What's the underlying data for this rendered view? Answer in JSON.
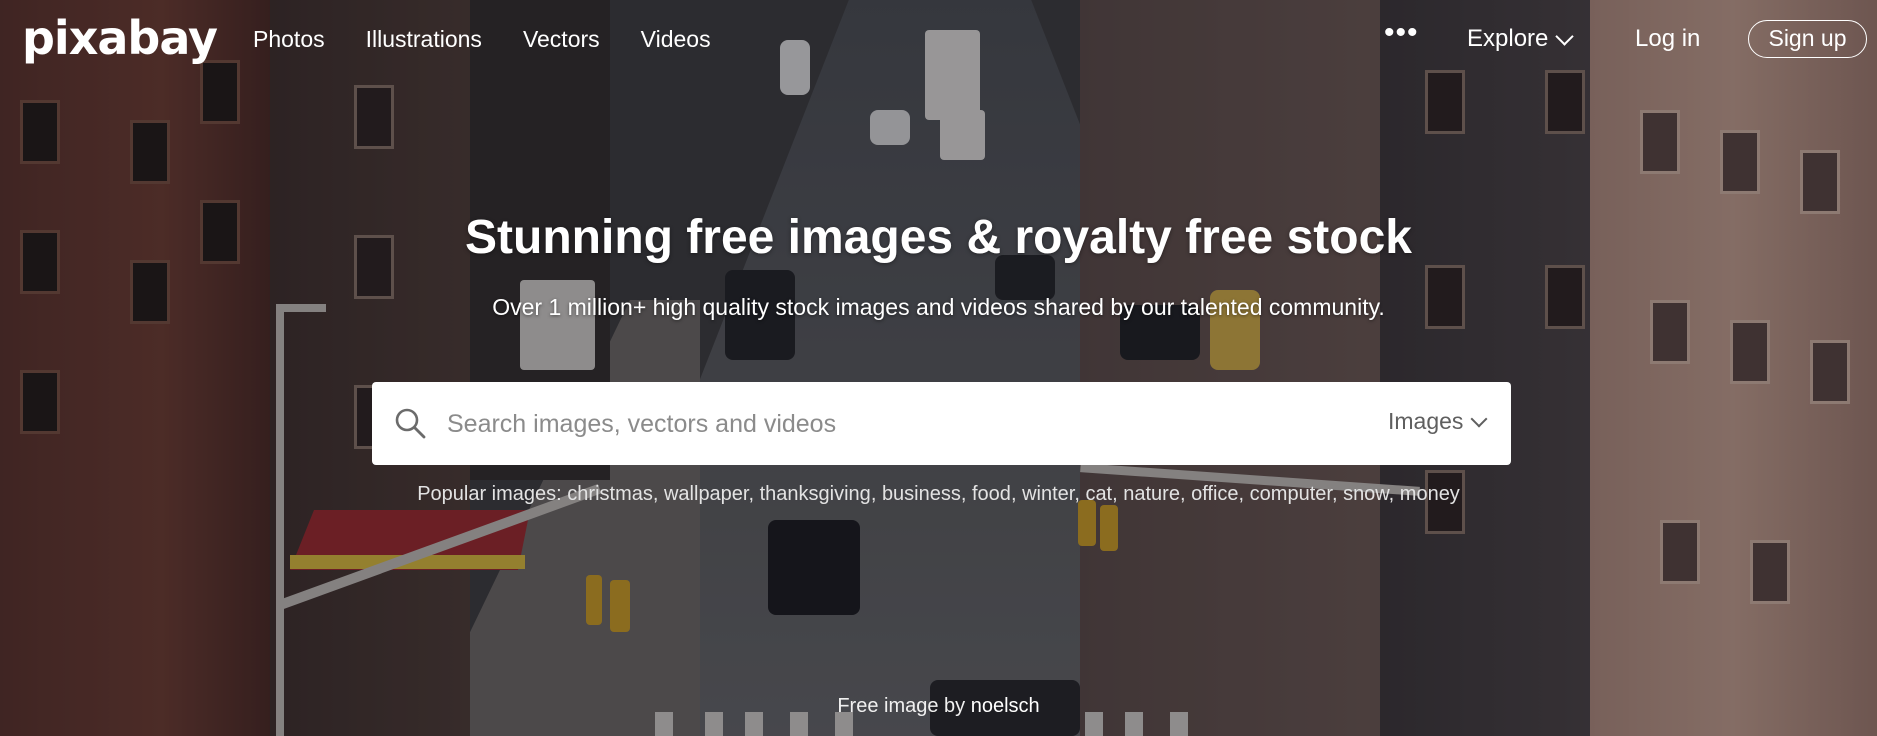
{
  "header": {
    "logo": "pixabay",
    "nav": [
      "Photos",
      "Illustrations",
      "Vectors",
      "Videos"
    ],
    "more": "•••",
    "explore": "Explore",
    "login": "Log in",
    "signup": "Sign up"
  },
  "hero": {
    "title": "Stunning free images & royalty free stock",
    "subtitle": "Over 1 million+ high quality stock images and videos shared by our talented community."
  },
  "search": {
    "placeholder": "Search images, vectors and videos",
    "value": "",
    "type": "Images"
  },
  "popular": {
    "label": "Popular images:",
    "tags": [
      "christmas",
      "wallpaper",
      "thanksgiving",
      "business",
      "food",
      "winter",
      "cat",
      "nature",
      "office",
      "computer",
      "snow",
      "money"
    ]
  },
  "credit": {
    "prefix": "Free image by",
    "author": "noelsch"
  },
  "icons": {
    "search": "search-icon",
    "chevron": "chevron-down-icon"
  }
}
